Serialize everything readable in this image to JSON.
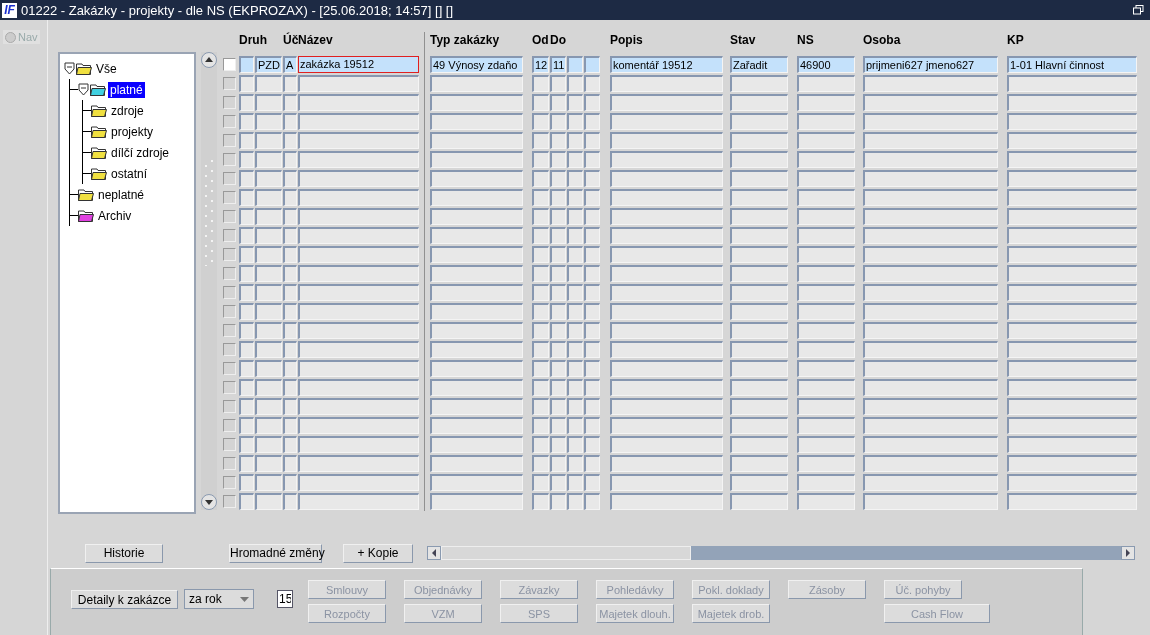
{
  "window": {
    "logo": "IF",
    "title": "01222 - Zakázky - projekty - dle NS (EKPROZAX) - [25.06.2018; 14:57] [] []"
  },
  "nav": {
    "label": "Nav",
    "checked": false,
    "disabled": true
  },
  "tree": [
    {
      "label": "Vše",
      "color": "#f0e040",
      "expanded": true,
      "selected": false,
      "children": [
        {
          "label": "platné",
          "color": "#40d0e0",
          "expanded": true,
          "selected": true,
          "children": [
            {
              "label": "zdroje",
              "color": "#f0e040",
              "selected": false
            },
            {
              "label": "projekty",
              "color": "#f0e040",
              "selected": false
            },
            {
              "label": "dílčí zdroje",
              "color": "#f0e040",
              "selected": false
            },
            {
              "label": "ostatní",
              "color": "#f0e040",
              "selected": false
            }
          ]
        },
        {
          "label": "neplatné",
          "color": "#f0e040",
          "selected": false
        },
        {
          "label": "Archiv",
          "color": "#e040e0",
          "selected": false
        }
      ]
    }
  ],
  "table": {
    "columns": [
      "Druh",
      "Úč",
      "Název",
      "Typ zakázky",
      "Od",
      "Do",
      "Popis",
      "Stav",
      "NS",
      "Osoba",
      "KP"
    ],
    "rows": [
      {
        "selected": true,
        "disabled": false,
        "checked": false,
        "cells": [
          {
            "text": "PZD",
            "focused": false
          },
          {
            "text": "A",
            "focused": false
          },
          {
            "text": "zakázka 19512",
            "focused": true
          },
          {
            "text": "49 Výnosy zdaňo",
            "focused": false
          },
          {
            "text": "12",
            "focused": false
          },
          {
            "text": "11",
            "focused": false
          },
          {
            "text": "komentář 19512",
            "focused": false
          },
          {
            "text": "Zařadit",
            "focused": false
          },
          {
            "text": "46900",
            "focused": false
          },
          {
            "text": "prijmeni627 jmeno627",
            "focused": false
          },
          {
            "text": "1-01 Hlavní činnost",
            "focused": false
          }
        ]
      },
      {
        "selected": false,
        "disabled": true
      },
      {
        "selected": false,
        "disabled": true
      },
      {
        "selected": false,
        "disabled": true
      },
      {
        "selected": false,
        "disabled": true
      },
      {
        "selected": false,
        "disabled": true
      },
      {
        "selected": false,
        "disabled": true
      },
      {
        "selected": false,
        "disabled": true
      },
      {
        "selected": false,
        "disabled": true
      },
      {
        "selected": false,
        "disabled": true
      },
      {
        "selected": false,
        "disabled": true
      },
      {
        "selected": false,
        "disabled": true
      },
      {
        "selected": false,
        "disabled": true
      },
      {
        "selected": false,
        "disabled": true
      },
      {
        "selected": false,
        "disabled": true
      },
      {
        "selected": false,
        "disabled": true
      },
      {
        "selected": false,
        "disabled": true
      },
      {
        "selected": false,
        "disabled": true
      },
      {
        "selected": false,
        "disabled": true
      },
      {
        "selected": false,
        "disabled": true
      },
      {
        "selected": false,
        "disabled": true
      },
      {
        "selected": false,
        "disabled": true
      },
      {
        "selected": false,
        "disabled": true
      },
      {
        "selected": false,
        "disabled": true
      }
    ]
  },
  "actions": [
    "Historie",
    "Hromadné změny",
    "+ Kopie"
  ],
  "details": {
    "button": "Detaily k zakázce",
    "period": "za rok",
    "value": "15",
    "buttons": [
      [
        {
          "label": "Smlouvy",
          "disabled": true
        },
        {
          "label": "Objednávky",
          "disabled": true
        },
        {
          "label": "Závazky",
          "disabled": true
        },
        {
          "label": "Pohledávky",
          "disabled": true
        },
        {
          "label": "Pokl. doklady",
          "disabled": true
        },
        {
          "label": "Zásoby",
          "disabled": true
        },
        {
          "label": "Úč. pohyby",
          "disabled": true
        }
      ],
      [
        {
          "label": "Rozpočty",
          "disabled": true
        },
        {
          "label": "VZM",
          "disabled": true
        },
        {
          "label": "SPS",
          "disabled": true
        },
        {
          "label": "Majetek dlouh.",
          "disabled": true
        },
        {
          "label": "Majetek drob.",
          "disabled": true
        },
        {
          "label": "Cash Flow",
          "disabled": true,
          "kind": "wide"
        }
      ]
    ]
  }
}
